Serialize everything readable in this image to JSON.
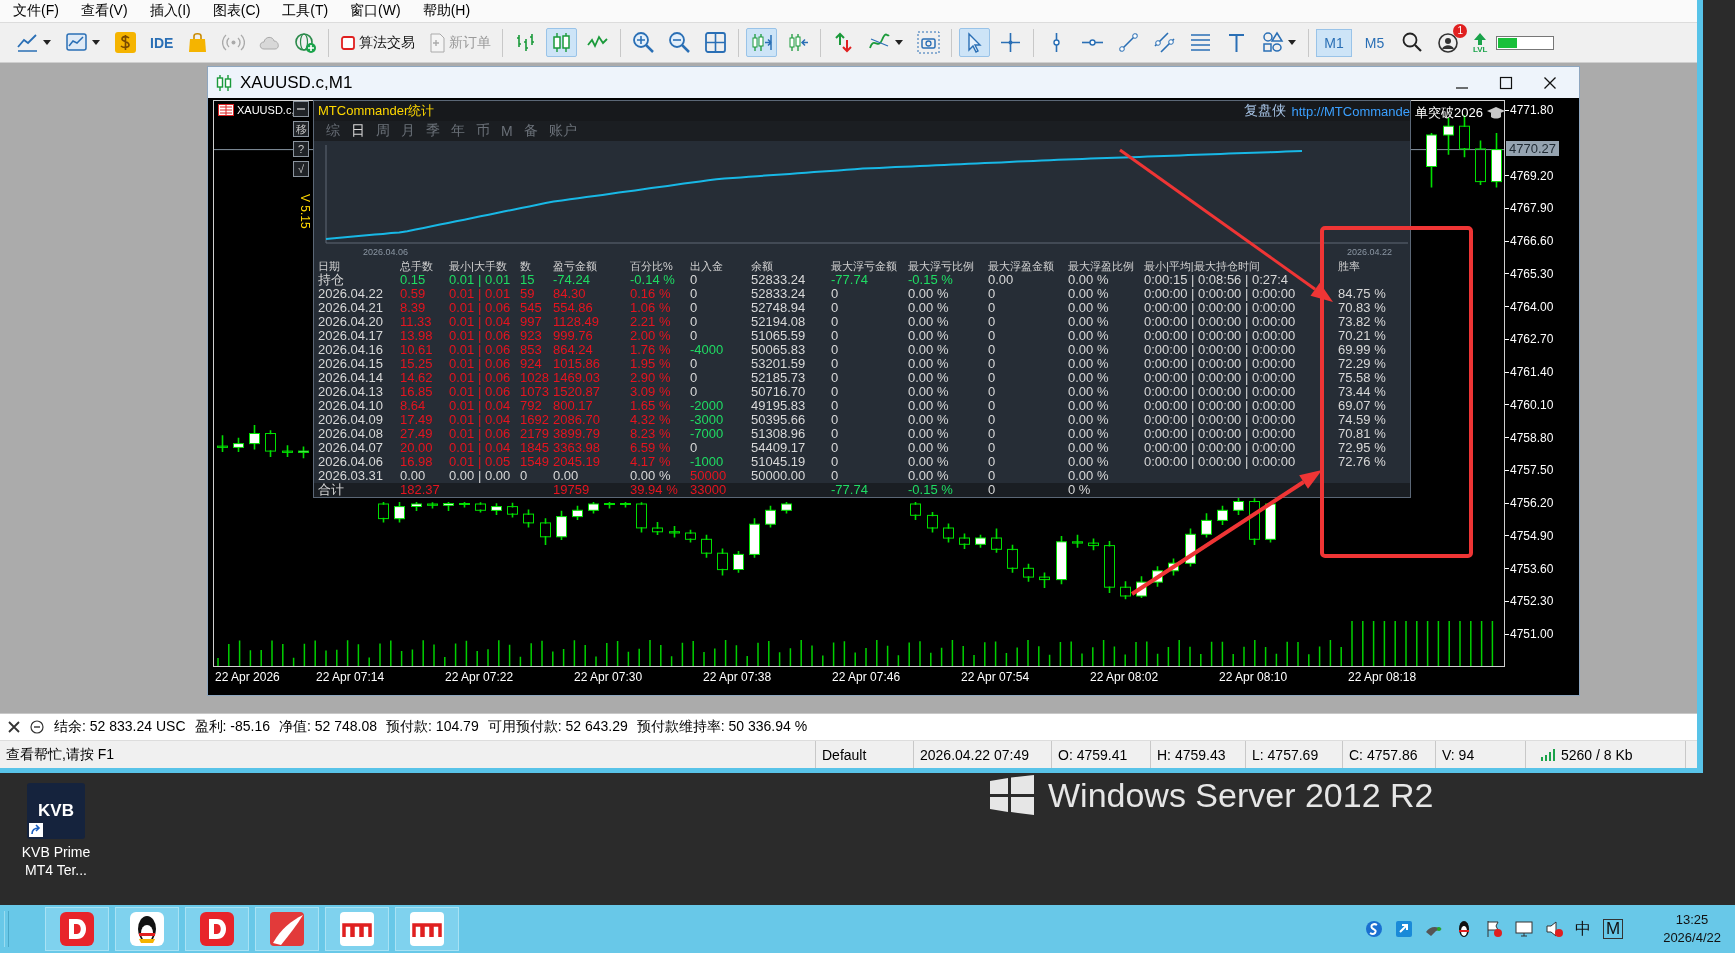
{
  "menu": [
    "文件(F)",
    "查看(V)",
    "插入(I)",
    "图表(C)",
    "工具(T)",
    "窗口(W)",
    "帮助(H)"
  ],
  "toolbar": {
    "ide": "IDE",
    "algo_trading": "算法交易",
    "new_order": {
      "label": "新订单",
      "disabled": true
    },
    "chart_type_buttons": [
      {
        "selected": false
      },
      {
        "selected": true
      },
      {
        "selected": false
      }
    ],
    "autoscroll": {
      "on": true
    },
    "chart_shift": {
      "on": false
    },
    "cursor_tools": [
      {
        "selected": true
      },
      {
        "selected": false
      }
    ],
    "timeframes": [
      {
        "label": "M1",
        "selected": true
      },
      {
        "label": "M5",
        "selected": false
      }
    ],
    "notification_badge": "1",
    "level_label": "LVL",
    "meter": {
      "level": 0.35
    }
  },
  "chart_window": {
    "title": "XAUUSD.c,M1",
    "first_date_label": "22 Apr 2026",
    "symbol_label": "XAUUSD.c,",
    "side_buttons": [
      "移",
      "?",
      "√"
    ],
    "version": "V 5.15",
    "comment": "单突破2026",
    "current_price": "4770.27",
    "chart_data": {
      "type": "candlestick",
      "categories": [
        null,
        null,
        null,
        null,
        null,
        null,
        null,
        null,
        "22 Apr 07:14",
        null,
        null,
        null,
        null,
        null,
        null,
        null,
        "22 Apr 07:22",
        null,
        null,
        null,
        null,
        null,
        null,
        null,
        "22 Apr 07:30",
        null,
        null,
        null,
        null,
        null,
        null,
        null,
        "22 Apr 07:38",
        null,
        null,
        null,
        null,
        null,
        null,
        null,
        "22 Apr 07:46",
        null,
        null,
        null,
        null,
        null,
        null,
        null,
        "22 Apr 07:54",
        null,
        null,
        null,
        null,
        null,
        null,
        null,
        "22 Apr 08:02",
        null,
        null,
        null,
        null,
        null,
        null,
        null,
        "22 Apr 08:10",
        null,
        null,
        null,
        null,
        null,
        null,
        null,
        "22 Apr 08:18",
        null,
        null,
        null,
        null,
        null,
        null,
        null
      ],
      "ylim": [
        4749.77,
        4772.2
      ],
      "ref_lines": [
        {
          "axis": "y",
          "value": 4770.27
        }
      ],
      "ohlc": [
        [
          4758.5,
          4758.9,
          4758.3,
          4758.45
        ],
        [
          4758.45,
          4758.8,
          4758.3,
          4758.6
        ],
        [
          4758.6,
          4759.3,
          4758.4,
          4759.0
        ],
        [
          4759.0,
          4759.1,
          4758.1,
          4758.3
        ],
        [
          4758.3,
          4758.5,
          4758.1,
          4758.25
        ],
        [
          4758.25,
          4758.45,
          4758.05,
          4758.3
        ],
        null,
        null,
        null,
        null,
        [
          4756.2,
          4756.25,
          4755.5,
          4755.62
        ],
        [
          4755.62,
          4756.25,
          4755.5,
          4756.1
        ],
        [
          4756.1,
          4756.25,
          4755.95,
          4756.2
        ],
        [
          4756.2,
          4756.24,
          4756.05,
          4756.15
        ],
        [
          4756.15,
          4756.25,
          4755.95,
          4756.22
        ],
        [
          4756.22,
          4756.25,
          4756.1,
          4756.2
        ],
        [
          4756.2,
          4756.24,
          4755.9,
          4755.95
        ],
        [
          4755.95,
          4756.2,
          4755.8,
          4756.1
        ],
        [
          4756.1,
          4756.22,
          4755.7,
          4755.8
        ],
        [
          4755.8,
          4755.95,
          4755.3,
          4755.45
        ],
        [
          4755.45,
          4755.6,
          4754.6,
          4754.9
        ],
        [
          4754.9,
          4755.9,
          4754.8,
          4755.7
        ],
        [
          4755.7,
          4756.1,
          4755.6,
          4755.95
        ],
        [
          4755.95,
          4756.25,
          4755.85,
          4756.2
        ],
        [
          4756.2,
          4756.25,
          4756.05,
          4756.22
        ],
        [
          4756.22,
          4756.25,
          4756.1,
          4756.2
        ],
        [
          4756.2,
          4756.24,
          4755.1,
          4755.25
        ],
        [
          4755.25,
          4755.45,
          4755.0,
          4755.1
        ],
        [
          4755.1,
          4755.3,
          4754.9,
          4755.05
        ],
        [
          4755.05,
          4755.15,
          4754.7,
          4754.8
        ],
        [
          4754.8,
          4754.95,
          4754.1,
          4754.25
        ],
        [
          4754.25,
          4754.4,
          4753.4,
          4753.6
        ],
        [
          4753.6,
          4754.3,
          4753.5,
          4754.2
        ],
        [
          4754.2,
          4755.6,
          4754.1,
          4755.4
        ],
        [
          4755.4,
          4756.1,
          4755.3,
          4755.95
        ],
        [
          4755.95,
          4756.25,
          4755.85,
          4756.2
        ],
        null,
        null,
        null,
        null,
        null,
        null,
        null,
        [
          4756.2,
          4756.25,
          4755.6,
          4755.75
        ],
        [
          4755.75,
          4755.85,
          4755.1,
          4755.25
        ],
        [
          4755.25,
          4755.4,
          4754.7,
          4754.85
        ],
        [
          4754.85,
          4755.0,
          4754.45,
          4754.6
        ],
        [
          4754.6,
          4754.95,
          4754.5,
          4754.85
        ],
        [
          4754.85,
          4755.2,
          4754.3,
          4754.4
        ],
        [
          4754.4,
          4754.55,
          4753.5,
          4753.65
        ],
        [
          4753.65,
          4753.8,
          4753.15,
          4753.3
        ],
        [
          4753.3,
          4753.45,
          4752.9,
          4753.2
        ],
        [
          4753.2,
          4754.9,
          4753.05,
          4754.7
        ],
        [
          4754.7,
          4754.95,
          4754.5,
          4754.65
        ],
        [
          4754.65,
          4754.8,
          4754.4,
          4754.55
        ],
        [
          4754.55,
          4754.7,
          4752.7,
          4752.9
        ],
        [
          4752.9,
          4753.1,
          4752.45,
          4752.55
        ],
        [
          4752.55,
          4753.3,
          4752.5,
          4753.1
        ],
        [
          4753.1,
          4753.7,
          4752.95,
          4753.55
        ],
        [
          4753.55,
          4754.0,
          4753.4,
          4753.85
        ],
        [
          4753.85,
          4755.2,
          4753.75,
          4755.0
        ],
        [
          4755.0,
          4755.8,
          4754.9,
          4755.55
        ],
        [
          4755.55,
          4756.1,
          4755.4,
          4755.95
        ],
        [
          4755.95,
          4756.45,
          4755.8,
          4756.3
        ],
        [
          4756.3,
          4756.4,
          4754.6,
          4754.8
        ],
        [
          4754.8,
          4756.25,
          4754.7,
          4756.2
        ],
        null,
        null,
        null,
        null,
        null,
        null,
        null,
        null,
        null,
        [
          4769.6,
          4770.9,
          4768.8,
          4770.85
        ],
        [
          4770.85,
          4771.5,
          4770.1,
          4771.2
        ],
        [
          4771.2,
          4771.6,
          4770.0,
          4770.3
        ],
        [
          4770.3,
          4770.6,
          4768.9,
          4769.0
        ],
        [
          4769.0,
          4770.9,
          4768.8,
          4770.27
        ]
      ],
      "yticks": [
        {
          "value": 4771.8,
          "label": "4771.80"
        },
        {
          "value": 4769.2,
          "label": "4769.20"
        },
        {
          "value": 4767.9,
          "label": "4767.90"
        },
        {
          "value": 4766.6,
          "label": "4766.60"
        },
        {
          "value": 4765.3,
          "label": "4765.30"
        },
        {
          "value": 4764.0,
          "label": "4764.00"
        },
        {
          "value": 4762.7,
          "label": "4762.70"
        },
        {
          "value": 4761.4,
          "label": "4761.40"
        },
        {
          "value": 4760.1,
          "label": "4760.10"
        },
        {
          "value": 4758.8,
          "label": "4758.80"
        },
        {
          "value": 4757.5,
          "label": "4757.50"
        },
        {
          "value": 4756.2,
          "label": "4756.20"
        },
        {
          "value": 4754.9,
          "label": "4754.90"
        },
        {
          "value": 4753.6,
          "label": "4753.60"
        },
        {
          "value": 4752.3,
          "label": "4752.30"
        },
        {
          "value": 4751.0,
          "label": "4751.00"
        }
      ]
    }
  },
  "stats_panel": {
    "title": "MTCommander统计",
    "credit": "复盘侠",
    "link": "http://MTCommande",
    "tabs": [
      {
        "label": "综",
        "selected": false
      },
      {
        "label": "日",
        "selected": true
      },
      {
        "label": "周",
        "selected": false
      },
      {
        "label": "月",
        "selected": false
      },
      {
        "label": "季",
        "selected": false
      },
      {
        "label": "年",
        "selected": false
      },
      {
        "label": "币",
        "selected": false
      },
      {
        "label": "M",
        "selected": false
      },
      {
        "label": "备",
        "selected": false
      },
      {
        "label": "账户",
        "selected": false
      }
    ],
    "equity_start": "2026.04.06",
    "equity_end": "2026.04.22",
    "columns": [
      "日期",
      "总手数",
      "最小|大手数",
      "数",
      "盈亏金额",
      "百分比%",
      "出入金",
      "余额",
      "最大浮亏金额",
      "最大浮亏比例",
      "最大浮盈金额",
      "最大浮盈比例",
      "最小|平均|最大持仓时间",
      "胜率"
    ],
    "rows": [
      {
        "cells": [
          {
            "text": "持仓"
          },
          {
            "text": "0.15",
            "color": "#1fdc63"
          },
          {
            "text": "0.01 | 0.01",
            "color": "#1fdc63"
          },
          {
            "text": "15",
            "color": "#1fdc63"
          },
          {
            "text": "-74.24",
            "color": "#1fdc63"
          },
          {
            "text": "-0.14 %",
            "color": "#1fdc63"
          },
          {
            "text": "0"
          },
          {
            "text": "52833.24"
          },
          {
            "text": "-77.74",
            "color": "#1fdc63"
          },
          {
            "text": "-0.15 %",
            "color": "#1fdc63"
          },
          {
            "text": "0.00"
          },
          {
            "text": "0.00 %"
          },
          {
            "text": "0:00:15 | 0:08:56 | 0:27:4"
          }
        ]
      },
      {
        "cells": [
          {
            "text": "2026.04.22"
          },
          {
            "text": "0.59",
            "color": "#e5141f"
          },
          {
            "text": "0.01 | 0.01",
            "color": "#e5141f"
          },
          {
            "text": "59",
            "color": "#e5141f"
          },
          {
            "text": "84.30",
            "color": "#e5141f"
          },
          {
            "text": "0.16 %",
            "color": "#e5141f"
          },
          {
            "text": "0"
          },
          {
            "text": "52833.24"
          },
          {
            "text": "0"
          },
          {
            "text": "0.00 %"
          },
          {
            "text": "0"
          },
          {
            "text": "0.00 %"
          },
          {
            "text": "0:00:00 | 0:00:00 | 0:00:00"
          },
          {
            "text": "84.75 %"
          }
        ]
      },
      {
        "cells": [
          {
            "text": "2026.04.21"
          },
          {
            "text": "8.39",
            "color": "#e5141f"
          },
          {
            "text": "0.01 | 0.06",
            "color": "#e5141f"
          },
          {
            "text": "545",
            "color": "#e5141f"
          },
          {
            "text": "554.86",
            "color": "#e5141f"
          },
          {
            "text": "1.06 %",
            "color": "#e5141f"
          },
          {
            "text": "0"
          },
          {
            "text": "52748.94"
          },
          {
            "text": "0"
          },
          {
            "text": "0.00 %"
          },
          {
            "text": "0"
          },
          {
            "text": "0.00 %"
          },
          {
            "text": "0:00:00 | 0:00:00 | 0:00:00"
          },
          {
            "text": "70.83 %"
          }
        ]
      },
      {
        "cells": [
          {
            "text": "2026.04.20"
          },
          {
            "text": "11.33",
            "color": "#e5141f"
          },
          {
            "text": "0.01 | 0.04",
            "color": "#e5141f"
          },
          {
            "text": "997",
            "color": "#e5141f"
          },
          {
            "text": "1128.49",
            "color": "#e5141f"
          },
          {
            "text": "2.21 %",
            "color": "#e5141f"
          },
          {
            "text": "0"
          },
          {
            "text": "52194.08"
          },
          {
            "text": "0"
          },
          {
            "text": "0.00 %"
          },
          {
            "text": "0"
          },
          {
            "text": "0.00 %"
          },
          {
            "text": "0:00:00 | 0:00:00 | 0:00:00"
          },
          {
            "text": "73.82 %"
          }
        ]
      },
      {
        "cells": [
          {
            "text": "2026.04.17"
          },
          {
            "text": "13.98",
            "color": "#e5141f"
          },
          {
            "text": "0.01 | 0.06",
            "color": "#e5141f"
          },
          {
            "text": "923",
            "color": "#e5141f"
          },
          {
            "text": "999.76",
            "color": "#e5141f"
          },
          {
            "text": "2.00 %",
            "color": "#e5141f"
          },
          {
            "text": "0"
          },
          {
            "text": "51065.59"
          },
          {
            "text": "0"
          },
          {
            "text": "0.00 %"
          },
          {
            "text": "0"
          },
          {
            "text": "0.00 %"
          },
          {
            "text": "0:00:00 | 0:00:00 | 0:00:00"
          },
          {
            "text": "70.21 %"
          }
        ]
      },
      {
        "cells": [
          {
            "text": "2026.04.16"
          },
          {
            "text": "10.61",
            "color": "#e5141f"
          },
          {
            "text": "0.01 | 0.06",
            "color": "#e5141f"
          },
          {
            "text": "853",
            "color": "#e5141f"
          },
          {
            "text": "864.24",
            "color": "#e5141f"
          },
          {
            "text": "1.76 %",
            "color": "#e5141f"
          },
          {
            "text": "-4000",
            "color": "#1fdc63"
          },
          {
            "text": "50065.83"
          },
          {
            "text": "0"
          },
          {
            "text": "0.00 %"
          },
          {
            "text": "0"
          },
          {
            "text": "0.00 %"
          },
          {
            "text": "0:00:00 | 0:00:00 | 0:00:00"
          },
          {
            "text": "69.99 %"
          }
        ]
      },
      {
        "cells": [
          {
            "text": "2026.04.15"
          },
          {
            "text": "15.25",
            "color": "#e5141f"
          },
          {
            "text": "0.01 | 0.06",
            "color": "#e5141f"
          },
          {
            "text": "924",
            "color": "#e5141f"
          },
          {
            "text": "1015.86",
            "color": "#e5141f"
          },
          {
            "text": "1.95 %",
            "color": "#e5141f"
          },
          {
            "text": "0"
          },
          {
            "text": "53201.59"
          },
          {
            "text": "0"
          },
          {
            "text": "0.00 %"
          },
          {
            "text": "0"
          },
          {
            "text": "0.00 %"
          },
          {
            "text": "0:00:00 | 0:00:00 | 0:00:00"
          },
          {
            "text": "72.29 %"
          }
        ]
      },
      {
        "cells": [
          {
            "text": "2026.04.14"
          },
          {
            "text": "14.62",
            "color": "#e5141f"
          },
          {
            "text": "0.01 | 0.06",
            "color": "#e5141f"
          },
          {
            "text": "1028",
            "color": "#e5141f"
          },
          {
            "text": "1469.03",
            "color": "#e5141f"
          },
          {
            "text": "2.90 %",
            "color": "#e5141f"
          },
          {
            "text": "0"
          },
          {
            "text": "52185.73"
          },
          {
            "text": "0"
          },
          {
            "text": "0.00 %"
          },
          {
            "text": "0"
          },
          {
            "text": "0.00 %"
          },
          {
            "text": "0:00:00 | 0:00:00 | 0:00:00"
          },
          {
            "text": "75.58 %"
          }
        ]
      },
      {
        "cells": [
          {
            "text": "2026.04.13"
          },
          {
            "text": "16.85",
            "color": "#e5141f"
          },
          {
            "text": "0.01 | 0.06",
            "color": "#e5141f"
          },
          {
            "text": "1073",
            "color": "#e5141f"
          },
          {
            "text": "1520.87",
            "color": "#e5141f"
          },
          {
            "text": "3.09 %",
            "color": "#e5141f"
          },
          {
            "text": "0"
          },
          {
            "text": "50716.70"
          },
          {
            "text": "0"
          },
          {
            "text": "0.00 %"
          },
          {
            "text": "0"
          },
          {
            "text": "0.00 %"
          },
          {
            "text": "0:00:00 | 0:00:00 | 0:00:00"
          },
          {
            "text": "73.44 %"
          }
        ]
      },
      {
        "cells": [
          {
            "text": "2026.04.10"
          },
          {
            "text": "8.64",
            "color": "#e5141f"
          },
          {
            "text": "0.01 | 0.04",
            "color": "#e5141f"
          },
          {
            "text": "792",
            "color": "#e5141f"
          },
          {
            "text": "800.17",
            "color": "#e5141f"
          },
          {
            "text": "1.65 %",
            "color": "#e5141f"
          },
          {
            "text": "-2000",
            "color": "#1fdc63"
          },
          {
            "text": "49195.83"
          },
          {
            "text": "0"
          },
          {
            "text": "0.00 %"
          },
          {
            "text": "0"
          },
          {
            "text": "0.00 %"
          },
          {
            "text": "0:00:00 | 0:00:00 | 0:00:00"
          },
          {
            "text": "69.07 %"
          }
        ]
      },
      {
        "cells": [
          {
            "text": "2026.04.09"
          },
          {
            "text": "17.49",
            "color": "#e5141f"
          },
          {
            "text": "0.01 | 0.04",
            "color": "#e5141f"
          },
          {
            "text": "1692",
            "color": "#e5141f"
          },
          {
            "text": "2086.70",
            "color": "#e5141f"
          },
          {
            "text": "4.32 %",
            "color": "#e5141f"
          },
          {
            "text": "-3000",
            "color": "#1fdc63"
          },
          {
            "text": "50395.66"
          },
          {
            "text": "0"
          },
          {
            "text": "0.00 %"
          },
          {
            "text": "0"
          },
          {
            "text": "0.00 %"
          },
          {
            "text": "0:00:00 | 0:00:00 | 0:00:00"
          },
          {
            "text": "74.59 %"
          }
        ]
      },
      {
        "cells": [
          {
            "text": "2026.04.08"
          },
          {
            "text": "27.49",
            "color": "#e5141f"
          },
          {
            "text": "0.01 | 0.06",
            "color": "#e5141f"
          },
          {
            "text": "2179",
            "color": "#e5141f"
          },
          {
            "text": "3899.79",
            "color": "#e5141f"
          },
          {
            "text": "8.23 %",
            "color": "#e5141f"
          },
          {
            "text": "-7000",
            "color": "#1fdc63"
          },
          {
            "text": "51308.96"
          },
          {
            "text": "0"
          },
          {
            "text": "0.00 %"
          },
          {
            "text": "0"
          },
          {
            "text": "0.00 %"
          },
          {
            "text": "0:00:00 | 0:00:00 | 0:00:00"
          },
          {
            "text": "70.81 %"
          }
        ]
      },
      {
        "cells": [
          {
            "text": "2026.04.07"
          },
          {
            "text": "20.00",
            "color": "#e5141f"
          },
          {
            "text": "0.01 | 0.04",
            "color": "#e5141f"
          },
          {
            "text": "1845",
            "color": "#e5141f"
          },
          {
            "text": "3363.98",
            "color": "#e5141f"
          },
          {
            "text": "6.59 %",
            "color": "#e5141f"
          },
          {
            "text": "0"
          },
          {
            "text": "54409.17"
          },
          {
            "text": "0"
          },
          {
            "text": "0.00 %"
          },
          {
            "text": "0"
          },
          {
            "text": "0.00 %"
          },
          {
            "text": "0:00:00 | 0:00:00 | 0:00:00"
          },
          {
            "text": "72.95 %"
          }
        ]
      },
      {
        "cells": [
          {
            "text": "2026.04.06"
          },
          {
            "text": "16.98",
            "color": "#e5141f"
          },
          {
            "text": "0.01 | 0.05",
            "color": "#e5141f"
          },
          {
            "text": "1549",
            "color": "#e5141f"
          },
          {
            "text": "2045.19",
            "color": "#e5141f"
          },
          {
            "text": "4.17 %",
            "color": "#e5141f"
          },
          {
            "text": "-1000",
            "color": "#1fdc63"
          },
          {
            "text": "51045.19"
          },
          {
            "text": "0"
          },
          {
            "text": "0.00 %"
          },
          {
            "text": "0"
          },
          {
            "text": "0.00 %"
          },
          {
            "text": "0:00:00 | 0:00:00 | 0:00:00"
          },
          {
            "text": "72.76 %"
          }
        ]
      },
      {
        "cells": [
          {
            "text": "2026.03.31"
          },
          {
            "text": "0.00"
          },
          {
            "text": "0.00 | 0.00"
          },
          {
            "text": "0"
          },
          {
            "text": "0.00"
          },
          {
            "text": "0.00 %"
          },
          {
            "text": "50000",
            "color": "#e5141f"
          },
          {
            "text": "50000.00"
          },
          {
            "text": "0"
          },
          {
            "text": "0.00 %"
          },
          {
            "text": "0"
          },
          {
            "text": "0.00 %"
          }
        ]
      }
    ],
    "total_row": {
      "label": "合计",
      "lots": {
        "text": "182.37",
        "color": "#e5141f"
      },
      "profit": {
        "text": "19759",
        "color": "#e5141f"
      },
      "percent": {
        "text": "39.94 %",
        "color": "#e5141f"
      },
      "flow": {
        "text": "33000",
        "color": "#e5141f"
      },
      "max_float_loss": {
        "text": "-77.74",
        "color": "#1fdc63"
      },
      "max_float_loss_pct": {
        "text": "-0.15 %",
        "color": "#1fdc63"
      },
      "max_float_profit": {
        "text": "0"
      },
      "max_float_profit_pct": {
        "text": "0 %"
      }
    }
  },
  "terminal": {
    "items": [
      "结余: 52 833.24 USC",
      "盈利: -85.16",
      "净值: 52 748.08",
      "预付款: 104.79",
      "可用预付款: 52 643.29",
      "预付款维持率: 50 336.94 %"
    ]
  },
  "status_bar": {
    "help": "查看帮忙,请按 F1",
    "profile": "Default",
    "time": "2026.04.22 07:49",
    "open": "O: 4759.41",
    "high": "H: 4759.43",
    "low": "L: 4757.69",
    "close": "C: 4757.86",
    "volume": "V: 94",
    "traffic": "5260 / 8 Kb"
  },
  "desktop": {
    "wallpaper_text": "Windows Server 2012 R2",
    "icons": [
      {
        "logo": "KVB",
        "label": "KVB Prime MT4 Ter..."
      }
    ]
  },
  "taskbar": {
    "ime": "中",
    "ime_mode": "M",
    "time": "13:25",
    "date": "2026/4/22"
  }
}
